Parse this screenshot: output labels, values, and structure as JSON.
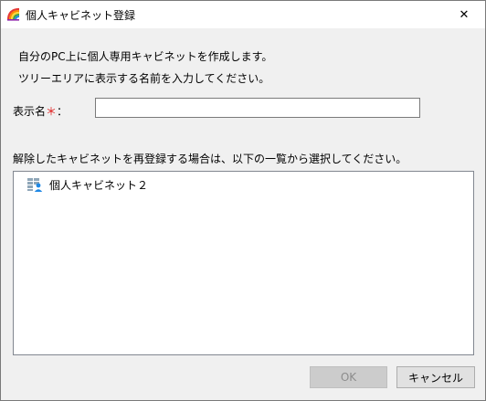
{
  "window": {
    "title": "個人キャビネット登録",
    "app_icon": "rainbow-app-icon",
    "close_icon": "close-icon",
    "close_glyph": "✕"
  },
  "description": {
    "line1": "自分のPC上に個人専用キャビネットを作成します。",
    "line2": "ツリーエリアに表示する名前を入力してください。"
  },
  "name_field": {
    "label": "表示名",
    "required_mark": "＊",
    "colon": "：",
    "value": "",
    "placeholder": ""
  },
  "list": {
    "description": "解除したキャビネットを再登録する場合は、以下の一覧から選択してください。",
    "items": [
      {
        "label": "個人キャビネット２",
        "icon": "personal-cabinet-icon"
      }
    ]
  },
  "buttons": {
    "ok_label": "OK",
    "ok_enabled": false,
    "cancel_label": "キャンセル"
  },
  "colors": {
    "required": "#e01818",
    "window_bg": "#f0f0f0",
    "disabled_text": "#8c8c8c"
  }
}
